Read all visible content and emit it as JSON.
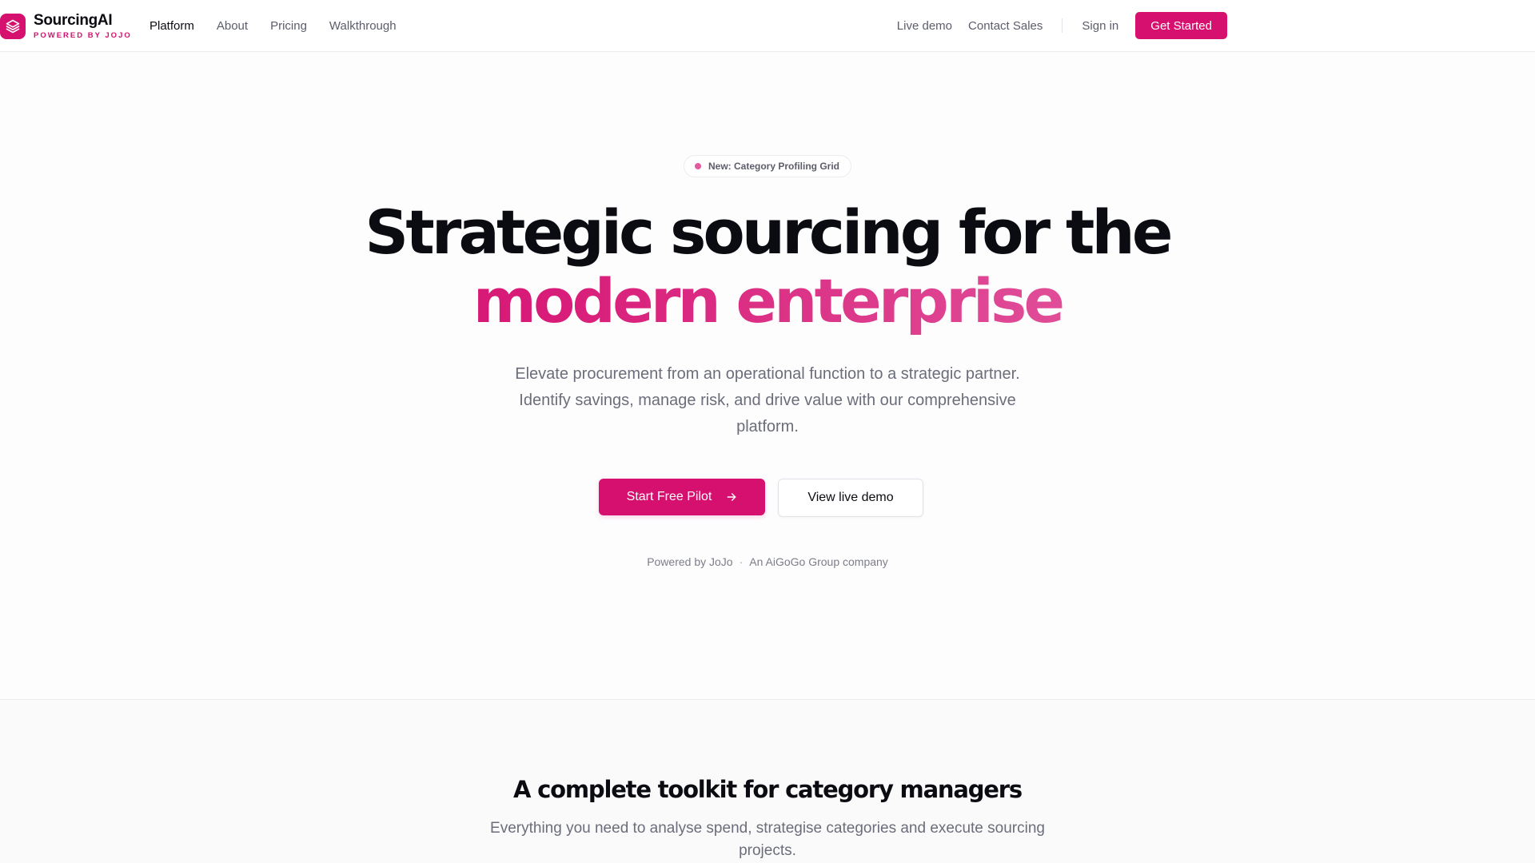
{
  "brand": {
    "name": "SourcingAI",
    "tagline": "POWERED BY JOJO",
    "logo_icon": "layers-icon",
    "color": "#d6106f"
  },
  "nav": {
    "links": [
      "Platform",
      "About",
      "Pricing",
      "Walkthrough"
    ],
    "active": "Platform",
    "right_links": [
      "Live demo",
      "Contact Sales"
    ],
    "signin_label": "Sign in",
    "cta_label": "Get Started"
  },
  "hero": {
    "badge_text": "New: Category Profiling Grid",
    "headline_line1": "Strategic sourcing for the",
    "headline_line2": "modern enterprise",
    "subtitle": "Elevate procurement from an operational function to a strategic partner. Identify savings, manage risk, and drive value with our comprehensive platform.",
    "primary_cta": "Start Free Pilot",
    "primary_cta_icon": "arrow-right-icon",
    "secondary_cta": "View live demo",
    "powered_by": "Powered by JoJo",
    "separator": "·",
    "company": "An AiGoGo Group company"
  },
  "toolkit": {
    "title": "A complete toolkit for category managers",
    "subtitle": "Everything you need to analyse spend, strategise categories and execute sourcing projects."
  },
  "colors": {
    "accent": "#d6106f",
    "accent_light": "#e668a8",
    "text_dark": "#0b0b12",
    "text_muted": "#6b6d7a"
  }
}
